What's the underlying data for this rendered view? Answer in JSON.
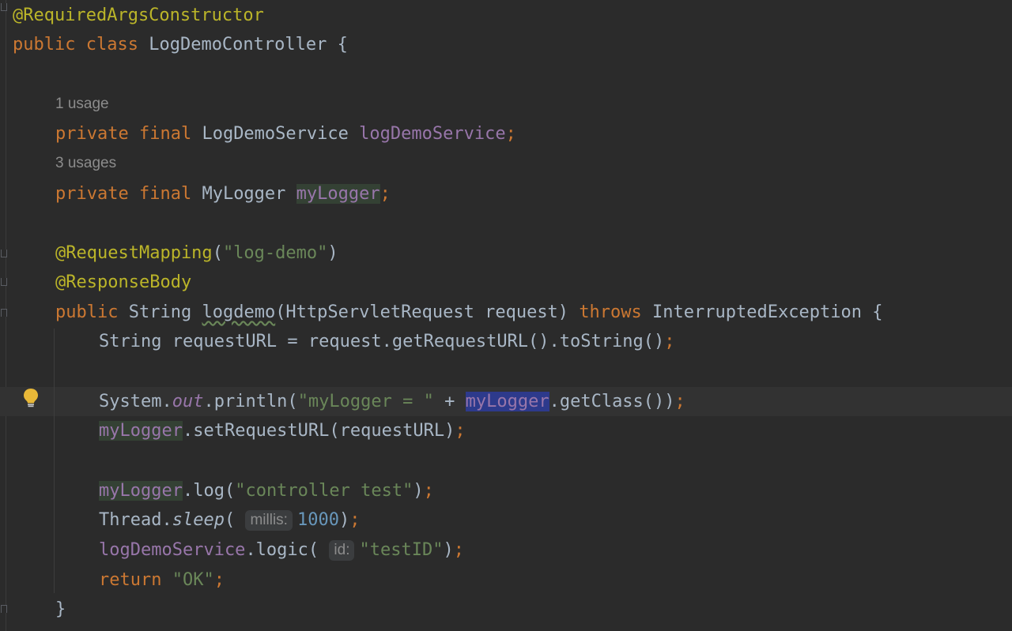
{
  "editor": {
    "lines": {
      "class_annotation": "@RequiredArgsConstructor",
      "class_decl_kw1": "public",
      "class_decl_kw2": "class",
      "class_name": "LogDemoController",
      "open_brace": "{",
      "usage_hint_1": "1 usage",
      "field1_kw1": "private",
      "field1_kw2": "final",
      "field1_type": "LogDemoService",
      "field1_name": "logDemoService",
      "semicolon": ";",
      "usage_hint_2": "3 usages",
      "field2_kw1": "private",
      "field2_kw2": "final",
      "field2_type": "MyLogger",
      "field2_name": "myLogger",
      "mapping_annotation": "@RequestMapping",
      "mapping_value": "\"log-demo\"",
      "responsebody_annotation": "@ResponseBody",
      "method_kw_public": "public",
      "method_return_type": "String",
      "method_name": "logdemo",
      "method_params": "(HttpServletRequest request)",
      "method_throws": "throws",
      "method_exception": "InterruptedException",
      "stmt1_left": "String requestURL = request.getRequestURL().toString()",
      "stmt2_system": "System.",
      "stmt2_out": "out",
      "stmt2_println": ".println(",
      "stmt2_string": "\"myLogger = \"",
      "stmt2_plus": " + ",
      "stmt2_mylogger": "myLogger",
      "stmt2_rest": ".getClass())",
      "stmt3_mylogger": "myLogger",
      "stmt3_rest": ".setRequestURL(requestURL)",
      "stmt4_mylogger": "myLogger",
      "stmt4_log": ".log(",
      "stmt4_string": "\"controller test\"",
      "stmt4_close": ")",
      "stmt5_thread": "Thread.",
      "stmt5_sleep": "sleep",
      "stmt5_open": "(",
      "stmt5_hint": "millis:",
      "stmt5_value": "1000",
      "stmt5_close": ")",
      "stmt6_service": "logDemoService",
      "stmt6_logic": ".logic(",
      "stmt6_hint": "id:",
      "stmt6_string": "\"testID\"",
      "stmt6_close": ")",
      "stmt7_return": "return",
      "stmt7_string": "\"OK\"",
      "close_brace": "}"
    },
    "icons": {
      "intention": "lightbulb-icon",
      "fold": "fold-marker-icon"
    },
    "colors": {
      "background": "#2b2b2b",
      "annotation": "#bbb529",
      "keyword": "#cc7832",
      "string": "#6a8759",
      "field": "#9876aa",
      "number": "#6897bb",
      "text": "#a9b7c6",
      "caret_highlight": "#2d3a8c",
      "read_highlight": "#344134",
      "bulb": "#e8b838"
    }
  }
}
